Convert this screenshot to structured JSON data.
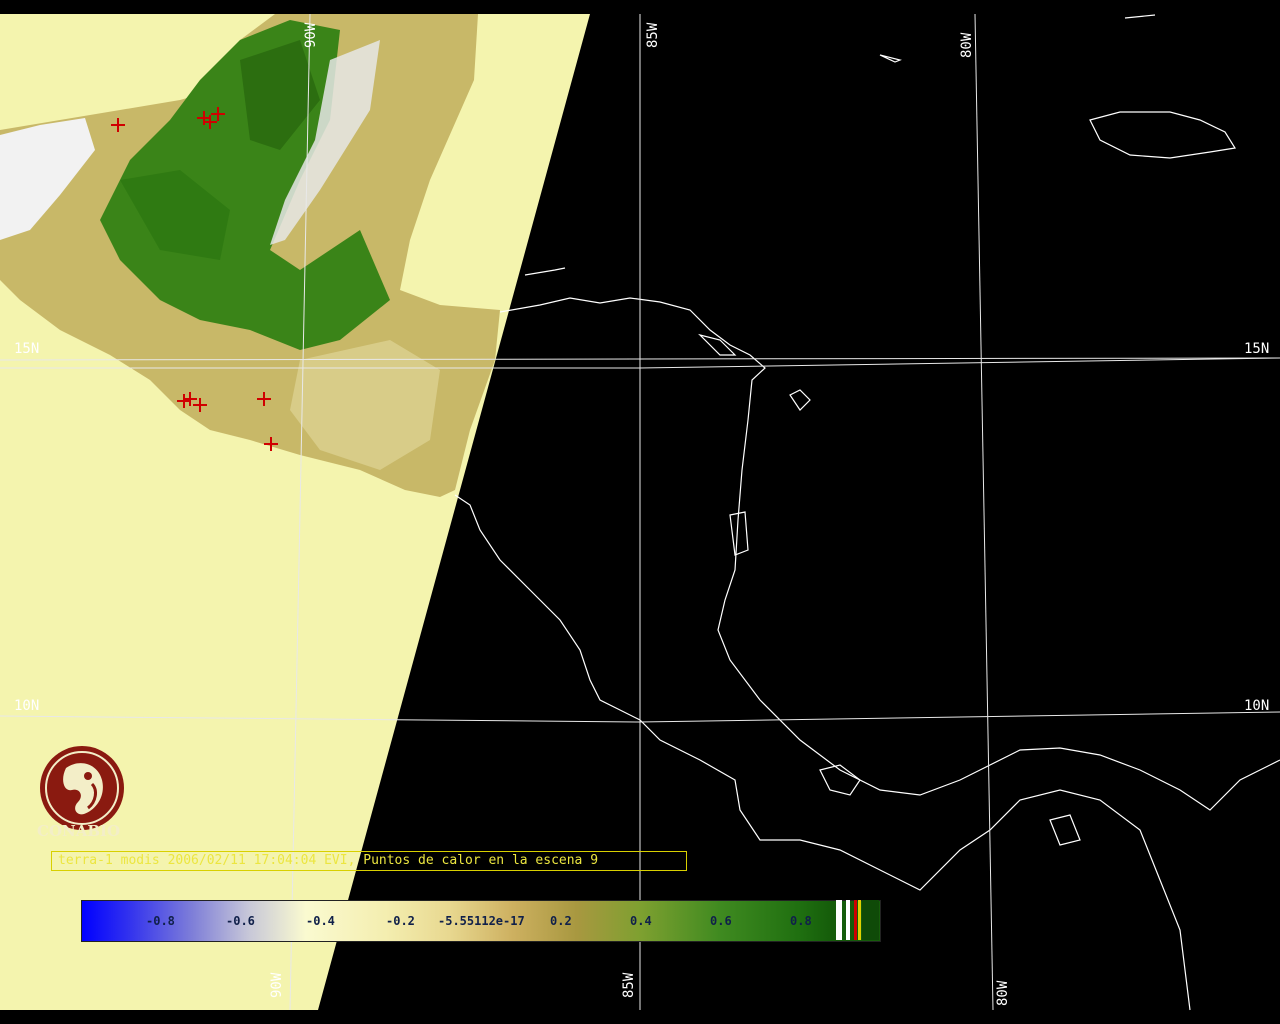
{
  "map": {
    "grid_labels": {
      "lon_90w_top": "90W",
      "lon_85w_top": "85W",
      "lon_80w_top": "80W",
      "lon_90w_bottom": "90W",
      "lon_85w_bottom": "85W",
      "lon_80w_bottom": "80W",
      "lat_15n_left": "15N",
      "lat_15n_right": "15N",
      "lat_10n_left": "10N",
      "lat_10n_right": "10N"
    },
    "colors": {
      "background": "#000000",
      "no_data_swath": "#f4f4ae",
      "vegetation_dark": "#2f7a12",
      "coastline": "#ffffff",
      "hotspot": "#d00000",
      "caption": "#ece640"
    },
    "hotspot_count": 9
  },
  "logo": {
    "text": "CONABIO",
    "icon": "macaw-seal-icon"
  },
  "caption": {
    "text": "terra-1 modis 2006/02/11 17:04:04 EVI, Puntos de calor en la escena 9"
  },
  "colorbar": {
    "tick_labels": [
      "-0.8",
      "-0.6",
      "-0.4",
      "-0.2",
      "-5.55112e-17",
      "0.2",
      "0.4",
      "0.6",
      "0.8"
    ],
    "range": [
      -1.0,
      1.0
    ]
  }
}
